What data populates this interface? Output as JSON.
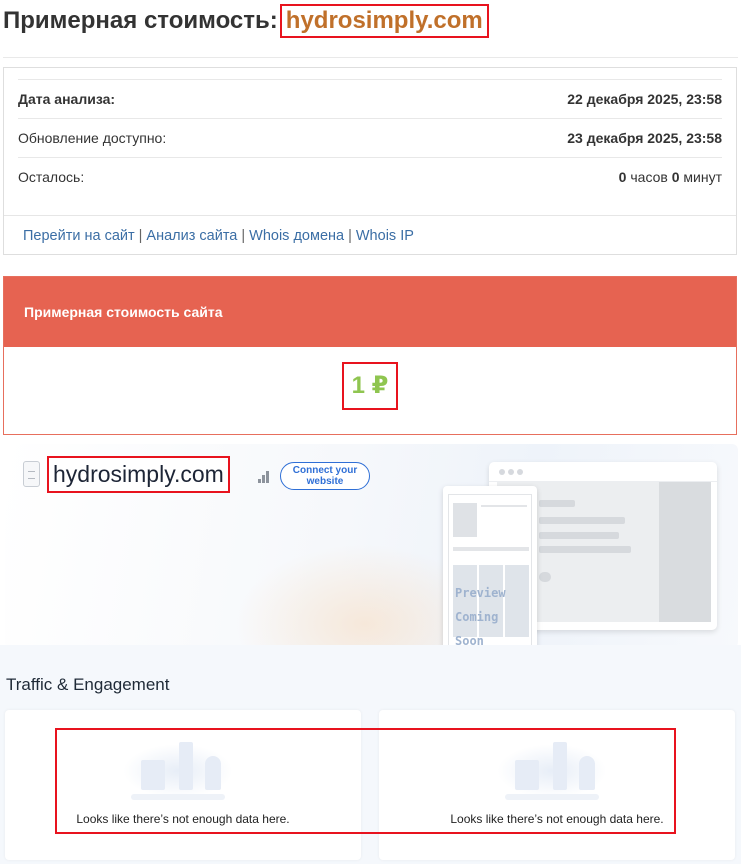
{
  "header": {
    "title_prefix": "Примерная стоимость:",
    "domain": "hydrosimply.com"
  },
  "info": {
    "analysis_date_label": "Дата анализа:",
    "analysis_date_value": "22 декабря 2025, 23:58",
    "update_label": "Обновление доступно:",
    "update_value": "23 декабря 2025, 23:58",
    "remaining_label": "Осталось:",
    "remaining_hours_num": "0",
    "remaining_hours_unit": "часов",
    "remaining_minutes_num": "0",
    "remaining_minutes_unit": "минут"
  },
  "links": {
    "goto_site": "Перейти на сайт",
    "site_analysis": "Анализ сайта",
    "whois_domain": "Whois домена",
    "whois_ip": "Whois IP",
    "separator": "|"
  },
  "price": {
    "header": "Примерная стоимость сайта",
    "value": "1 ₽"
  },
  "preview": {
    "domain": "hydrosimply.com",
    "connect_button": "Connect your website",
    "coming_soon_line1": "Preview",
    "coming_soon_line2": "Coming Soon"
  },
  "traffic": {
    "title": "Traffic & Engagement",
    "empty_message_left": "Looks like there’s not enough data here.",
    "empty_message_right": "Looks like there’s not enough data here."
  },
  "colors": {
    "highlight_frame": "#e8131e",
    "domain_text": "#c0702a",
    "price_header_bg": "#e66351",
    "price_value": "#8fc550",
    "link": "#3b6ea5",
    "connect_button": "#2f6fd6"
  }
}
